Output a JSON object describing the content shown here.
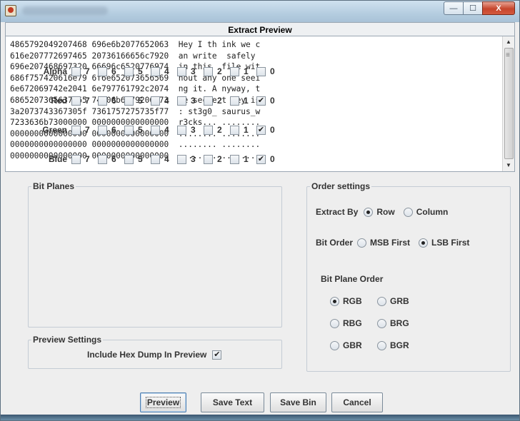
{
  "window": {
    "title_blurred": true,
    "controls": {
      "minimize": "—",
      "maximize": "☐",
      "close": "X"
    }
  },
  "preview": {
    "header": "Extract Preview",
    "lines": [
      "4865792049207468 696e6b2077652063  Hey I th ink we c",
      "616e207772697465 20736166656c7920  an write  safely ",
      "696e207468697320 66696c6520776974  in this  file wit",
      "686f757420616e79 6f6e652073656569  hout any one seei",
      "6e672069742e2041 6e797761792c2074  ng it. A nyway, t",
      "6865207365637265 74206b6579206973  he secre t key is",
      "3a2073743367305f 7361757275735f77  : st3g0_ saurus_w",
      "7233636b73000000 0000000000000000  r3cks... ........",
      "0000000000000000 0000000000000000  ........ ........",
      "0000000000000000 0000000000000000  ........ ........",
      "0000000000000000 0000000000000000  ........ ........"
    ]
  },
  "bit_planes": {
    "title": "Bit Planes",
    "bits": [
      "7",
      "6",
      "5",
      "4",
      "3",
      "2",
      "1",
      "0"
    ],
    "rows": [
      {
        "label": "Alpha",
        "checked": [
          false,
          false,
          false,
          false,
          false,
          false,
          false,
          false
        ]
      },
      {
        "label": "Red",
        "checked": [
          false,
          false,
          false,
          false,
          false,
          false,
          false,
          true
        ]
      },
      {
        "label": "Green",
        "checked": [
          false,
          false,
          false,
          false,
          false,
          false,
          false,
          true
        ]
      },
      {
        "label": "Blue",
        "checked": [
          false,
          false,
          false,
          false,
          false,
          false,
          false,
          true
        ]
      }
    ]
  },
  "preview_settings": {
    "title": "Preview Settings",
    "hex_dump_label": "Include Hex Dump In Preview",
    "hex_dump_checked": true
  },
  "order_settings": {
    "title": "Order settings",
    "extract_by_label": "Extract By",
    "extract_by_options": [
      "Row",
      "Column"
    ],
    "extract_by_selected": "Row",
    "bit_order_label": "Bit Order",
    "bit_order_options": [
      "MSB First",
      "LSB First"
    ],
    "bit_order_selected": "LSB First",
    "plane_order_label": "Bit Plane Order",
    "plane_order_options": [
      "RGB",
      "GRB",
      "RBG",
      "BRG",
      "GBR",
      "BGR"
    ],
    "plane_order_selected": "RGB"
  },
  "buttons": {
    "preview": "Preview",
    "save_text": "Save Text",
    "save_bin": "Save Bin",
    "cancel": "Cancel"
  }
}
